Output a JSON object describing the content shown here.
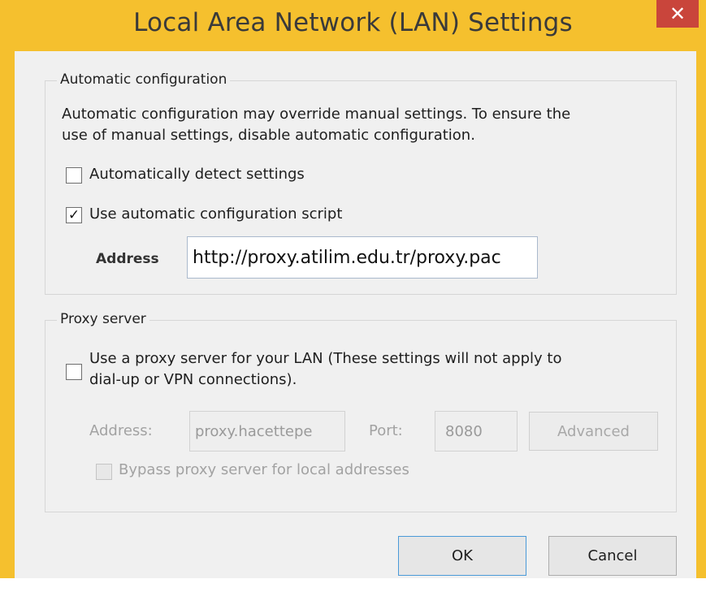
{
  "window": {
    "title": "Local Area Network (LAN) Settings",
    "close_glyph": "✕"
  },
  "auto_config": {
    "group_label": "Automatic configuration",
    "description_line1": "Automatic configuration may override manual settings.  To ensure the",
    "description_line2": "use of manual settings, disable automatic configuration.",
    "detect_label": "Automatically detect settings",
    "detect_checked": false,
    "script_label": "Use automatic configuration script",
    "script_checked": true,
    "script_check_glyph": "✓",
    "address_label": "Address",
    "address_value": "http://proxy.atilim.edu.tr/proxy.pac"
  },
  "proxy": {
    "group_label": "Proxy server",
    "use_proxy_line1": "Use a proxy server for your LAN (These settings will not apply to",
    "use_proxy_line2": "dial-up or VPN connections).",
    "use_proxy_checked": false,
    "address_label": "Address:",
    "address_value": "proxy.hacettepe",
    "port_label": "Port:",
    "port_value": "8080",
    "advanced_label": "Advanced",
    "bypass_label": "Bypass proxy server for local addresses",
    "bypass_checked": false
  },
  "buttons": {
    "ok_label": "OK",
    "cancel_label": "Cancel"
  },
  "colors": {
    "title_bar": "#f5c02e",
    "close_button": "#c9453b",
    "dialog_body": "#f0f0f0"
  }
}
